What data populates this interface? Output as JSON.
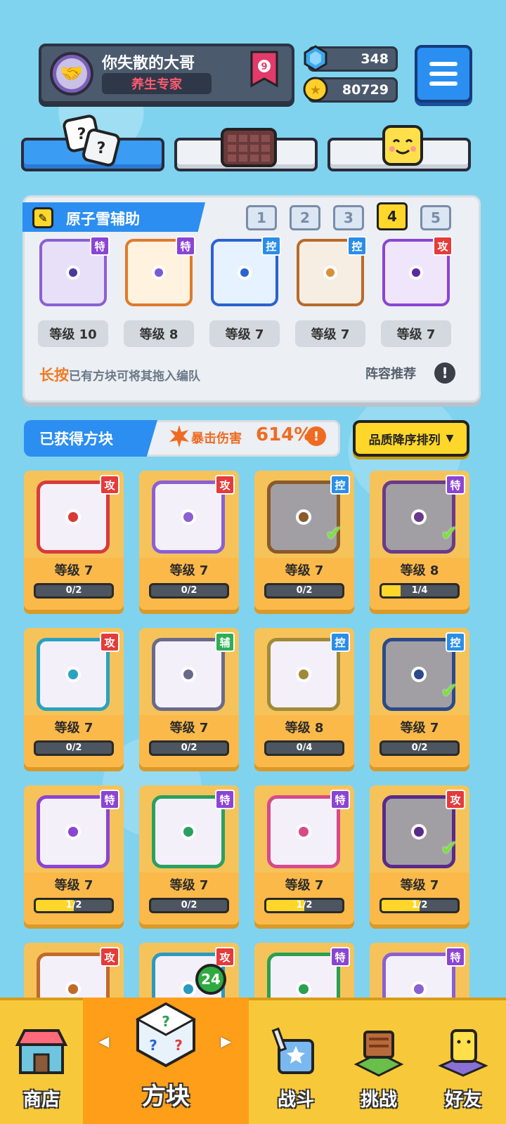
{
  "player": {
    "name": "你失散的大哥",
    "title": "养生专家",
    "rank": "9"
  },
  "currency": {
    "gems": "348",
    "coins": "80729"
  },
  "team": {
    "title": "原子雪辅助",
    "slots": [
      "1",
      "2",
      "3",
      "4",
      "5"
    ],
    "active_slot": 4,
    "members": [
      {
        "tag": "特",
        "type": "spc",
        "level": "等级 10",
        "color": "#8a60d4"
      },
      {
        "tag": "特",
        "type": "spc",
        "level": "等级 8",
        "color": "#e07a2a"
      },
      {
        "tag": "控",
        "type": "ctl",
        "level": "等级 7",
        "color": "#2a62d0"
      },
      {
        "tag": "控",
        "type": "ctl",
        "level": "等级 7",
        "color": "#b86a2a"
      },
      {
        "tag": "攻",
        "type": "atk",
        "level": "等级 7",
        "color": "#8a45d4"
      }
    ],
    "hint_highlight": "长按",
    "hint_text": "已有方块可将其拖入编队",
    "recommend": "阵容推荐",
    "recommend_icon": "!"
  },
  "obtained": {
    "title": "已获得方块",
    "crit_label": "暴击伤害",
    "crit_value": "614%",
    "crit_icon": "!",
    "sort_label": "品质降序排列",
    "sort_arrow": "▼"
  },
  "cards": [
    {
      "tag": "攻",
      "type": "atk",
      "level": "等级 7",
      "progress": "0/2",
      "fill": 0,
      "color": "#d83a3a",
      "owned": false
    },
    {
      "tag": "攻",
      "type": "atk",
      "level": "等级 7",
      "progress": "0/2",
      "fill": 0,
      "color": "#8a60d4",
      "owned": false
    },
    {
      "tag": "控",
      "type": "ctl",
      "level": "等级 7",
      "progress": "0/2",
      "fill": 0,
      "color": "#8a5a2a",
      "owned": true
    },
    {
      "tag": "特",
      "type": "spc",
      "level": "等级 8",
      "progress": "1/4",
      "fill": 0.25,
      "color": "#6a3a8a",
      "owned": true
    },
    {
      "tag": "攻",
      "type": "atk",
      "level": "等级 7",
      "progress": "0/2",
      "fill": 0,
      "color": "#2aa2c0",
      "owned": false
    },
    {
      "tag": "辅",
      "type": "sup",
      "level": "等级 7",
      "progress": "0/2",
      "fill": 0,
      "color": "#6a6a8a",
      "owned": false
    },
    {
      "tag": "控",
      "type": "ctl",
      "level": "等级 8",
      "progress": "0/4",
      "fill": 0,
      "color": "#a08a3a",
      "owned": false
    },
    {
      "tag": "控",
      "type": "ctl",
      "level": "等级 7",
      "progress": "0/2",
      "fill": 0,
      "color": "#2a4a8a",
      "owned": true
    },
    {
      "tag": "特",
      "type": "spc",
      "level": "等级 7",
      "progress": "1/2",
      "fill": 0.5,
      "color": "#8a45d4",
      "owned": false
    },
    {
      "tag": "特",
      "type": "spc",
      "level": "等级 7",
      "progress": "0/2",
      "fill": 0,
      "color": "#2aa060",
      "owned": false
    },
    {
      "tag": "特",
      "type": "spc",
      "level": "等级 7",
      "progress": "1/2",
      "fill": 0.5,
      "color": "#d84a8a",
      "owned": false
    },
    {
      "tag": "攻",
      "type": "atk",
      "level": "等级 7",
      "progress": "1/2",
      "fill": 0.5,
      "color": "#5a2a8a",
      "owned": true
    },
    {
      "tag": "攻",
      "type": "atk",
      "color": "#c06a2a"
    },
    {
      "tag": "攻",
      "type": "atk",
      "color": "#2a9ac0"
    },
    {
      "tag": "特",
      "type": "spc",
      "color": "#2aa050"
    },
    {
      "tag": "特",
      "type": "spc",
      "color": "#8a60d4"
    }
  ],
  "nav": {
    "shop": "商店",
    "blocks": "方块",
    "blocks_badge": "24",
    "battle": "战斗",
    "challenge": "挑战",
    "friends": "好友",
    "arrow_left": "◀",
    "arrow_right": "▶"
  },
  "colors": {
    "accent_blue": "#2b8ef0",
    "gold": "#ffd72a",
    "card_bg": "#f6c35a"
  }
}
